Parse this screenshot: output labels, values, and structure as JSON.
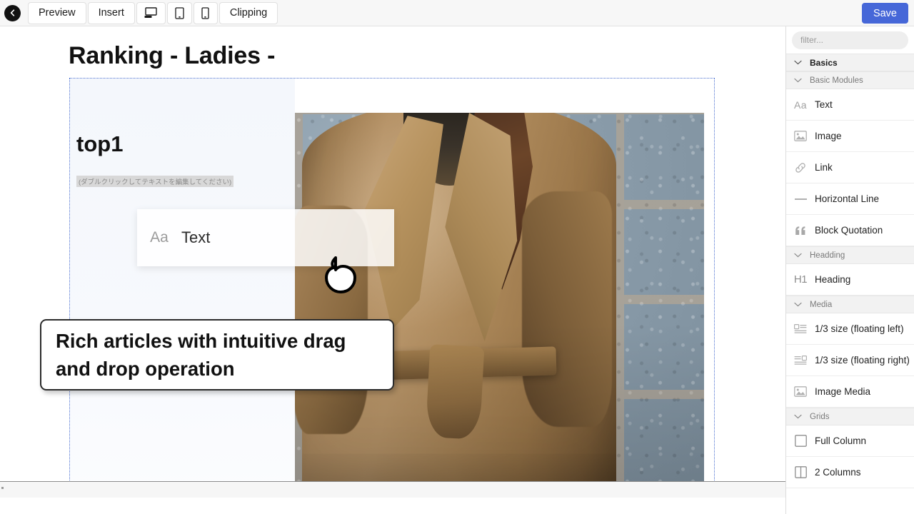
{
  "toolbar": {
    "back_icon": "arrow-left-icon",
    "buttons": [
      {
        "label": "Preview",
        "name": "preview-button"
      },
      {
        "label": "Insert",
        "name": "insert-button"
      }
    ],
    "device_buttons": [
      {
        "icon": "desktop-icon",
        "name": "device-desktop-button"
      },
      {
        "icon": "tablet-icon",
        "name": "device-tablet-button"
      },
      {
        "icon": "mobile-icon",
        "name": "device-mobile-button"
      }
    ],
    "clipping_label": "Clipping",
    "save_label": "Save",
    "save_color": "#4667d8"
  },
  "canvas": {
    "page_title": "Ranking - Ladies -",
    "block": {
      "heading": "top1",
      "placeholder_text": "(ダブルクリックしてテキストを編集してください)",
      "selection_border_color": "#4a6fd0"
    },
    "photo": {
      "alt": "Woman wearing a camel trench coat in front of a stone brick wall"
    },
    "drag_ghost": {
      "icon": "text-aa-icon",
      "icon_text": "Aa",
      "label": "Text"
    },
    "cursor": "pointing-hand-cursor",
    "callout": {
      "text": "Rich articles with intuitive drag and drop operation"
    }
  },
  "panel": {
    "filter_placeholder": "filter...",
    "filter_value": "",
    "groups": [
      {
        "label": "Basics",
        "level": 0,
        "chevron": "chevron-down-icon"
      },
      {
        "label": "Basic Modules",
        "level": 1,
        "chevron": "chevron-down-icon"
      }
    ],
    "items": [
      {
        "label": "Text",
        "icon": "text-aa-icon",
        "glyph": "Aa",
        "name": "module-text"
      },
      {
        "label": "Image",
        "icon": "image-icon",
        "name": "module-image"
      },
      {
        "label": "Link",
        "icon": "link-icon",
        "name": "module-link"
      },
      {
        "label": "Horizontal Line",
        "icon": "horizontal-line-icon",
        "name": "module-horizontal-line"
      },
      {
        "label": "Block Quotation",
        "icon": "quote-icon",
        "glyph": "“",
        "name": "module-block-quotation"
      }
    ],
    "group_headding": {
      "label": "Headding",
      "chevron": "chevron-down-icon"
    },
    "heading_item": {
      "label": "Heading",
      "icon": "h1-icon",
      "glyph": "H1",
      "name": "module-heading"
    },
    "group_media": {
      "label": "Media",
      "chevron": "chevron-down-icon"
    },
    "media_items": [
      {
        "label": "1/3 size (floating left)",
        "icon": "float-left-icon",
        "name": "module-third-float-left"
      },
      {
        "label": "1/3 size (floating right)",
        "icon": "float-right-icon",
        "name": "module-third-float-right"
      },
      {
        "label": "Image Media",
        "icon": "image-icon",
        "name": "module-image-media"
      }
    ],
    "group_grids": {
      "label": "Grids",
      "chevron": "chevron-down-icon"
    },
    "grid_items": [
      {
        "label": "Full Column",
        "icon": "full-column-icon",
        "name": "module-full-column"
      },
      {
        "label": "2 Columns",
        "icon": "two-columns-icon",
        "name": "module-two-columns"
      }
    ]
  }
}
